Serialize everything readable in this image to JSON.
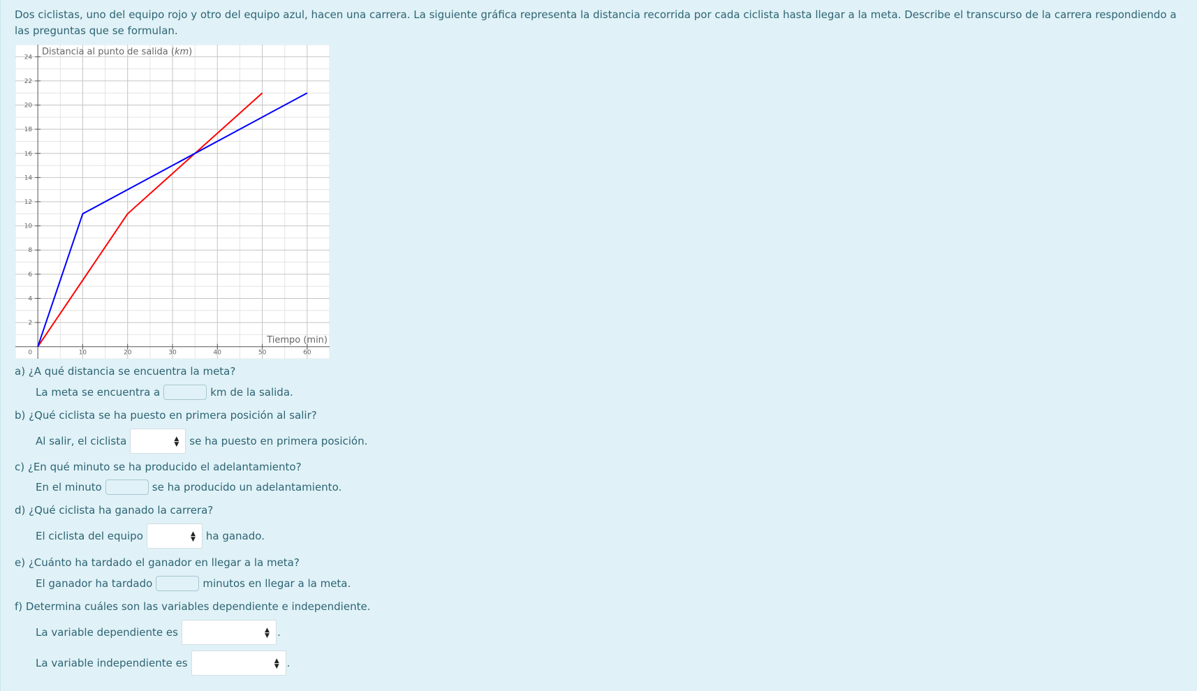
{
  "statement": "Dos ciclistas, uno del equipo rojo y otro del equipo azul, hacen una carrera. La siguiente gráfica representa la distancia recorrida por cada ciclista hasta llegar a la meta. Describe el transcurso de la carrera respondiendo a las preguntas que se formulan.",
  "chart_data": {
    "type": "line",
    "ylabel_prefix": "Distancia al punto de salida (",
    "ylabel_unit": "km",
    "ylabel_suffix": ")",
    "xlabel": "Tiempo (min)",
    "xlim": [
      -5,
      65
    ],
    "ylim": [
      -1,
      25
    ],
    "x_ticks": [
      10,
      20,
      30,
      40,
      50,
      60
    ],
    "y_ticks": [
      2,
      4,
      6,
      8,
      10,
      12,
      14,
      16,
      18,
      20,
      22,
      24
    ],
    "origin_label": "0",
    "grid": true,
    "series": [
      {
        "color": "#ff0000",
        "points": [
          [
            0,
            0
          ],
          [
            20,
            11
          ],
          [
            50,
            21
          ]
        ]
      },
      {
        "color": "#0000ff",
        "points": [
          [
            0,
            0
          ],
          [
            10,
            11
          ],
          [
            60,
            21
          ]
        ]
      }
    ]
  },
  "questions": {
    "a": {
      "q": "a) ¿A qué distancia se encuentra la meta?",
      "pre": "La meta se encuentra a",
      "post": "km de la salida."
    },
    "b": {
      "q": "b) ¿Qué ciclista se ha puesto en primera posición al salir?",
      "pre": "Al salir, el ciclista",
      "post": "se ha puesto en primera posición.",
      "select_value": ""
    },
    "c": {
      "q": "c) ¿En qué minuto se ha producido el adelantamiento?",
      "pre": "En el minuto",
      "post": "se ha producido un adelantamiento."
    },
    "d": {
      "q": "d) ¿Qué ciclista ha ganado la carrera?",
      "pre": "El ciclista del equipo",
      "post": "ha ganado.",
      "select_value": ""
    },
    "e": {
      "q": "e) ¿Cuánto ha tardado el ganador en llegar a la meta?",
      "pre": "El ganador ha tardado",
      "post": "minutos en llegar a la meta."
    },
    "f": {
      "q": "f) Determina cuáles son las variables dependiente e independiente.",
      "pre1": "La variable dependiente es",
      "post1": ".",
      "pre2": "La variable independiente es",
      "post2": ".",
      "select1_value": "",
      "select2_value": ""
    }
  },
  "icons": {
    "select_arrow": "sort-arrows-icon"
  }
}
